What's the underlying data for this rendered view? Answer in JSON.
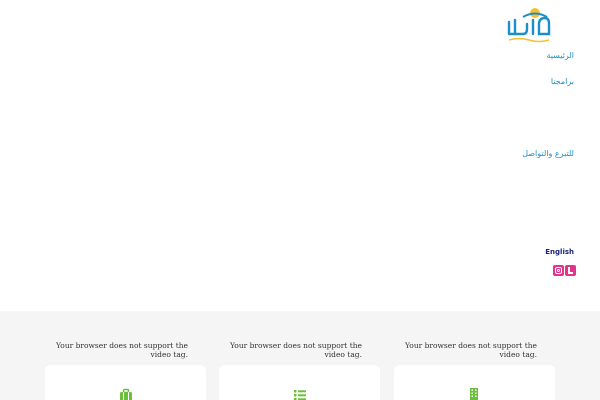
{
  "brand": {
    "logo_icon": "afaq-logo-icon",
    "colors": {
      "accent": "#1a8fc9",
      "lang": "#1a237e",
      "social": "#e0358a",
      "feature_icon": "#6cbf3c",
      "section_bg": "#f5f5f5"
    }
  },
  "nav": {
    "home": "الرئيسية",
    "programs": "برامجنا",
    "contact": "للتبرع والتواصل",
    "language": "English"
  },
  "social": [
    {
      "icon": "instagram-icon"
    },
    {
      "icon": "social-icon"
    }
  ],
  "features": [
    {
      "video_message": "Your browser does not support the video tag.",
      "icon": "briefcase-icon"
    },
    {
      "video_message": "Your browser does not support the video tag.",
      "icon": "list-icon"
    },
    {
      "video_message": "Your browser does not support the video tag.",
      "icon": "building-icon"
    }
  ]
}
